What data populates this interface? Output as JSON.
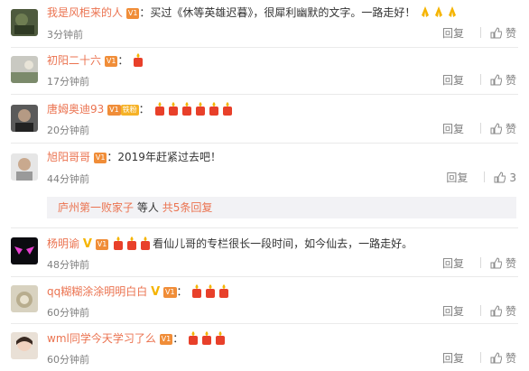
{
  "labels": {
    "reply": "回复",
    "like": "赞"
  },
  "comments": [
    {
      "user": "我是风柜来的人",
      "text": "：买过《休等英雄迟暮》，很犀利幽默的文字。一路走好！",
      "time": "3分钟前",
      "likes": "",
      "badge": "V1",
      "extras": "pray x3"
    },
    {
      "user": "初阳二十六",
      "text": "：",
      "time": "17分钟前",
      "likes": "",
      "badge": "V1",
      "extras": "candle x1"
    },
    {
      "user": "唐姆奥迪93",
      "text": "：",
      "time": "20分钟前",
      "likes": "",
      "badge": "V1",
      "fan_label": "铁粉",
      "extras": "candle x6"
    },
    {
      "user": "旭阳哥哥",
      "text": "：2019年赶紧过去吧！",
      "time": "44分钟前",
      "likes": "3",
      "badge": "V1"
    },
    {
      "user": "杨明谕",
      "text": "看仙儿哥的专栏很长一段时间，如今仙去，一路走好。",
      "time": "48分钟前",
      "likes": "",
      "badge": "V1",
      "verified": "V",
      "extras": "candle x3"
    },
    {
      "user": "qq糊糊涂涂明明白白",
      "text": "：",
      "time": "60分钟前",
      "likes": "",
      "badge": "V1",
      "verified": "V",
      "extras": "candle x3"
    },
    {
      "user": "wml同学今天学习了么",
      "text": "：",
      "time": "60分钟前",
      "likes": "",
      "badge": "V1",
      "extras": "candle x3"
    }
  ],
  "reply_summary": {
    "user": "庐州第一败家子",
    "middle": "等人",
    "link": "共5条回复"
  }
}
